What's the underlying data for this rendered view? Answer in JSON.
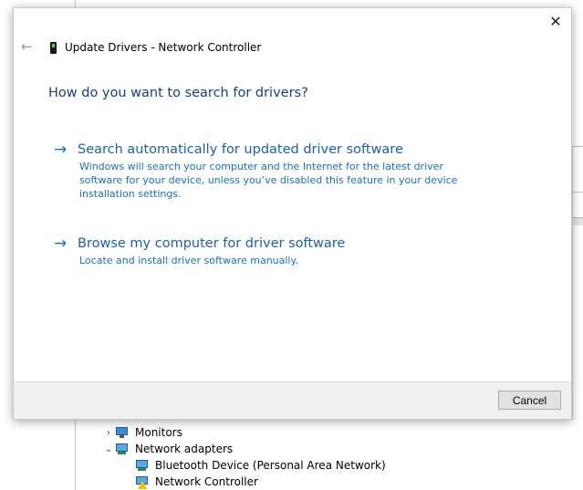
{
  "dialog": {
    "title": "Update Drivers - Network Controller",
    "close_icon": "✕",
    "back_icon": "←",
    "heading": "How do you want to search for drivers?",
    "options": [
      {
        "arrow": "→",
        "title": "Search automatically for updated driver software",
        "description": "Windows will search your computer and the Internet for the latest driver software for your device, unless you’ve disabled this feature in your device installation settings."
      },
      {
        "arrow": "→",
        "title": "Browse my computer for driver software",
        "description": "Locate and install driver software manually."
      }
    ],
    "cancel_label": "Cancel"
  },
  "device_tree": {
    "items": [
      {
        "label": "Monitors",
        "expander": "›",
        "icon": "monitor-icon"
      },
      {
        "label": "Network adapters",
        "expander": "⌄",
        "icon": "network-adapter-icon"
      },
      {
        "label": "Bluetooth Device (Personal Area Network)",
        "icon": "network-adapter-icon"
      },
      {
        "label": "Network Controller",
        "icon": "warning-device-icon"
      }
    ]
  },
  "colors": {
    "link": "#1c5fb0",
    "heading": "#1a3e78",
    "footer": "#f0f0f0"
  }
}
